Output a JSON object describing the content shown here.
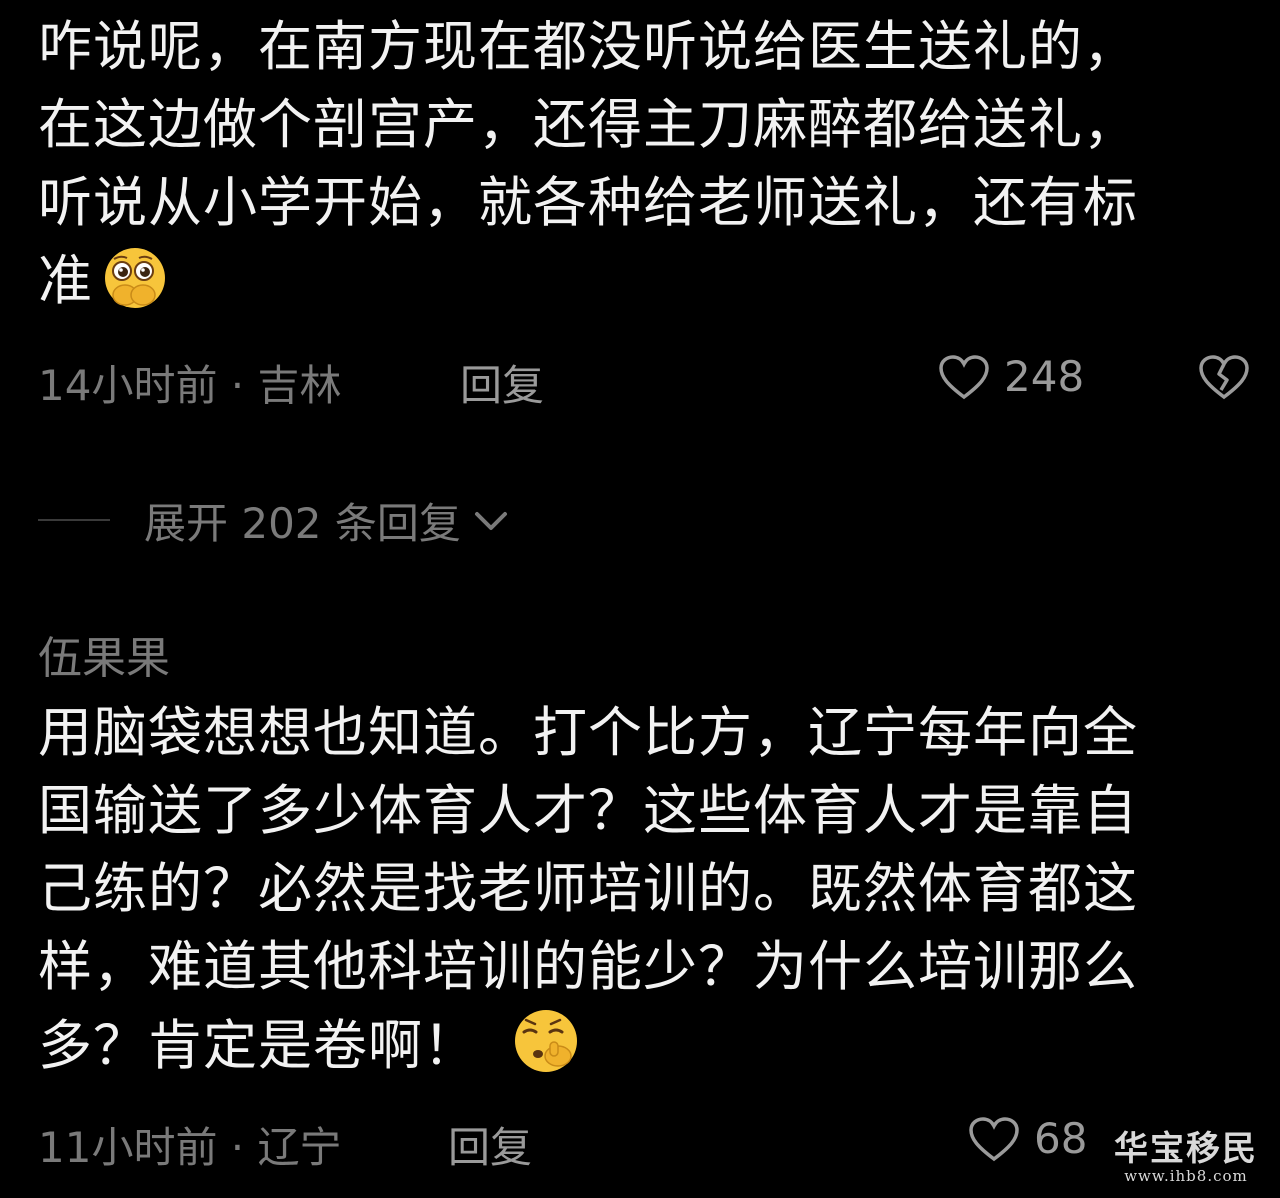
{
  "comments": [
    {
      "lines": [
        "咋说呢，在南方现在都没听说给医生送礼的，",
        "在这边做个剖宫产，还得主刀麻醉都给送礼，",
        "听说从小学开始，就各种给老师送礼，还有标",
        "准"
      ],
      "emoji": "hand-over-mouth-pleading-emoji",
      "time_location": "14小时前 · 吉林",
      "reply_label": "回复",
      "like_count": "248"
    },
    {
      "username": "伍果果",
      "lines": [
        "用脑袋想想也知道。打个比方，辽宁每年向全",
        "国输送了多少体育人才？这些体育人才是靠自",
        "己练的？必然是找老师培训的。既然体育都这",
        "样，难道其他科培训的能少？为什么培训那么",
        "多？肯定是卷啊！"
      ],
      "emoji": "shushing-face-emoji",
      "time_location": "11小时前 · 辽宁",
      "reply_label": "回复",
      "like_count": "68"
    }
  ],
  "expand_replies": {
    "label": "展开 202 条回复"
  },
  "watermark": {
    "title": "华宝移民",
    "url": "www.ihb8.com"
  },
  "colors": {
    "background": "#000000",
    "text": "#f2f2f2",
    "meta": "#7a7a7a",
    "emoji_yellow": "#f7c53b"
  }
}
